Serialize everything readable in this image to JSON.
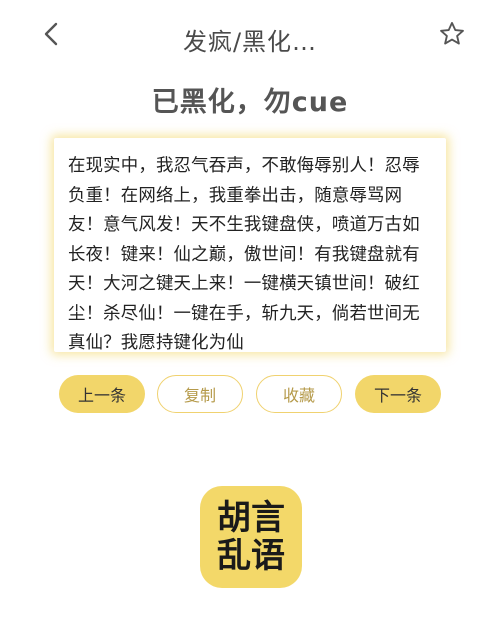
{
  "header": {
    "title": "发疯/黑化…",
    "back_icon": "chevron-left-icon",
    "favorite_icon": "star-outline-icon"
  },
  "heading": "已黑化，勿cue",
  "quote": {
    "text": "在现实中，我忍气吞声，不敢侮辱别人！忍辱负重！在网络上，我重拳出击，随意辱骂网友！意气风发！天不生我键盘侠，喷道万古如长夜！键来！仙之巅，傲世间！有我键盘就有天！大河之键天上来！一键横天镇世间！破红尘！杀尽仙！一键在手，斩九天，倘若世间无真仙？我愿持键化为仙"
  },
  "actions": {
    "prev_label": "上一条",
    "copy_label": "复制",
    "collect_label": "收藏",
    "next_label": "下一条"
  },
  "logo": {
    "line1": "胡言",
    "line2": "乱语"
  },
  "colors": {
    "accent": "#f2d66a",
    "outline": "#f0d270",
    "outline_text": "#b59a4a",
    "card_glow": "#f0d25a"
  }
}
